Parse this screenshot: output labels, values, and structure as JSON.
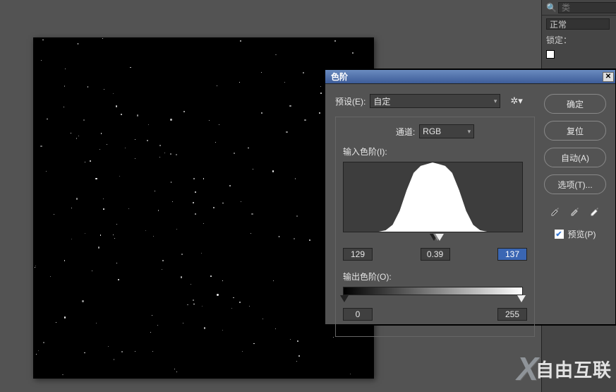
{
  "right_panel": {
    "search_placeholder": "类",
    "mode": "正常",
    "lock_label": "锁定："
  },
  "dialog": {
    "title": "色阶",
    "preset_label": "预设(E):",
    "preset_value": "自定",
    "channel_label": "通道:",
    "channel_value": "RGB",
    "input_label": "输入色阶(I):",
    "input_black": "129",
    "input_gamma": "0.39",
    "input_white": "137",
    "output_label": "输出色阶(O):",
    "output_black": "0",
    "output_white": "255",
    "buttons": {
      "ok": "确定",
      "reset": "复位",
      "auto": "自动(A)",
      "options": "选项(T)..."
    },
    "preview_label": "预览(P)"
  },
  "watermark": {
    "text": "自由互联"
  }
}
